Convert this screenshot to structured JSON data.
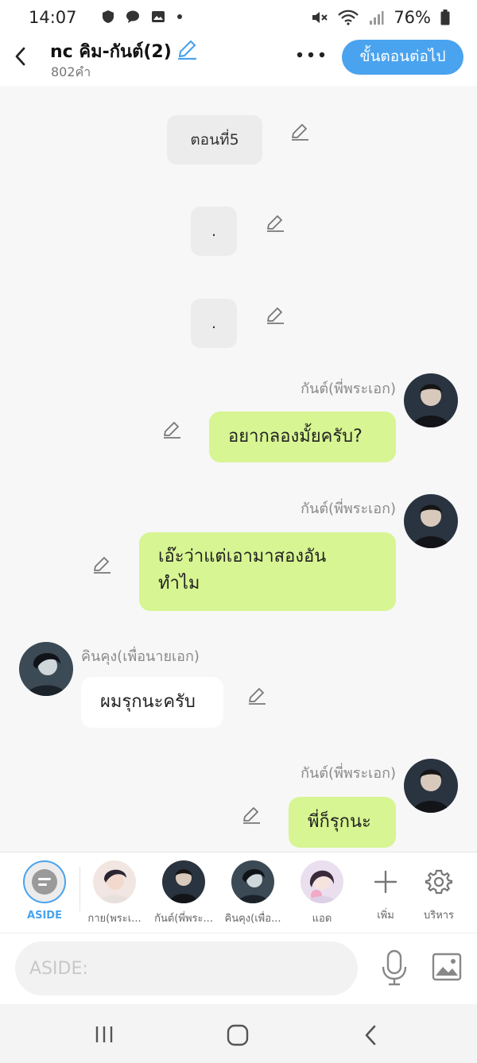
{
  "status": {
    "time": "14:07",
    "battery": "76%"
  },
  "header": {
    "title": "nc คิม-กันต์(2)",
    "word_count": "802คำ",
    "next_button": "ขั้นตอนต่อไป"
  },
  "messages": {
    "chapter_label": "ตอนที่5",
    "dot1": ".",
    "dot2": ".",
    "m1": {
      "sender": "กันต์(พี่พระเอก)",
      "text": "อยากลองมั้ยครับ?"
    },
    "m2": {
      "sender": "กันต์(พี่พระเอก)",
      "line1": "เอ๊ะว่าแต่เอามาสองอัน",
      "line2": "ทำไม"
    },
    "m3": {
      "sender": "คินคุง(เพื่อนายเอก)",
      "text": "ผมรุกนะครับ"
    },
    "m4": {
      "sender": "กันต์(พี่พระเอก)",
      "text": "พี่ก็รุกนะ"
    }
  },
  "cast": {
    "aside": "ASIDE",
    "c1": "กาย(พระเ...",
    "c2": "กันต์(พี่พระ...",
    "c3": "คินคุง(เพื่อ...",
    "c4": "แอด",
    "add": "เพิ่ม",
    "manage": "บริหาร"
  },
  "composer": {
    "placeholder": "ASIDE:"
  },
  "colors": {
    "accent": "#4aa3ee",
    "bubble_right": "#d7f592",
    "bubble_center": "#ececec"
  },
  "icons": [
    "back-arrow-icon",
    "edit-pencil-icon",
    "more-dots-icon",
    "settings-gear-icon",
    "plus-icon",
    "mic-icon",
    "image-icon"
  ]
}
